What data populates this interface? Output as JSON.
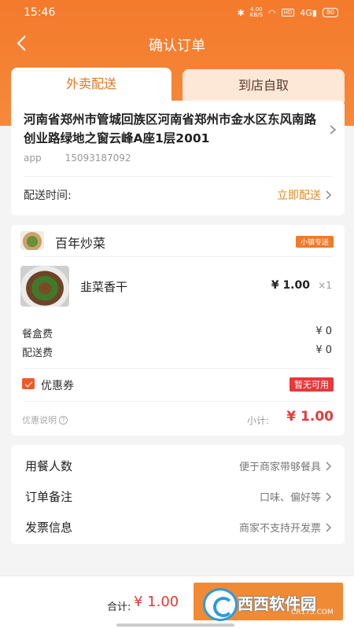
{
  "status_bar": {
    "time": "15:46",
    "speed_value": "4.00",
    "speed_unit": "KB/S",
    "hd": "HD",
    "signal": "4G",
    "battery": "80"
  },
  "header": {
    "title": "确认订单"
  },
  "tabs": [
    {
      "label": "外卖配送",
      "active": true
    },
    {
      "label": "到店自取",
      "active": false
    }
  ],
  "address": {
    "text": "河南省郑州市管城回族区河南省郑州市金水区东风南路创业路绿地之窗云峰A座1层2001",
    "name": "app",
    "phone": "15093187092",
    "delivery_time_label": "配送时间:",
    "delivery_time_value": "立即配送"
  },
  "order": {
    "shop_name": "百年炒菜",
    "shop_tag": "小镇专送",
    "items": [
      {
        "name": "韭菜香干",
        "price": "¥ 1.00",
        "qty": "×1"
      }
    ],
    "fees": [
      {
        "label": "餐盒费",
        "value": "¥ 0"
      },
      {
        "label": "配送费",
        "value": "¥ 0"
      }
    ],
    "coupon_label": "优惠券",
    "coupon_status": "暂无可用",
    "promo_note": "优惠说明",
    "subtotal_label": "小计:",
    "subtotal_value": "¥ 1.00"
  },
  "extra": [
    {
      "label": "用餐人数",
      "value": "便于商家带够餐具"
    },
    {
      "label": "订单备注",
      "value": "口味、偏好等"
    },
    {
      "label": "发票信息",
      "value": "商家不支持开发票"
    }
  ],
  "footer": {
    "total_label": "合计:",
    "total_value": "¥ 1.00"
  },
  "watermark": {
    "text": "西西软件园",
    "site": "CR173.COM"
  },
  "colors": {
    "primary": "#f47a2c",
    "price": "#e6393a",
    "accent_text": "#e28a1e"
  }
}
